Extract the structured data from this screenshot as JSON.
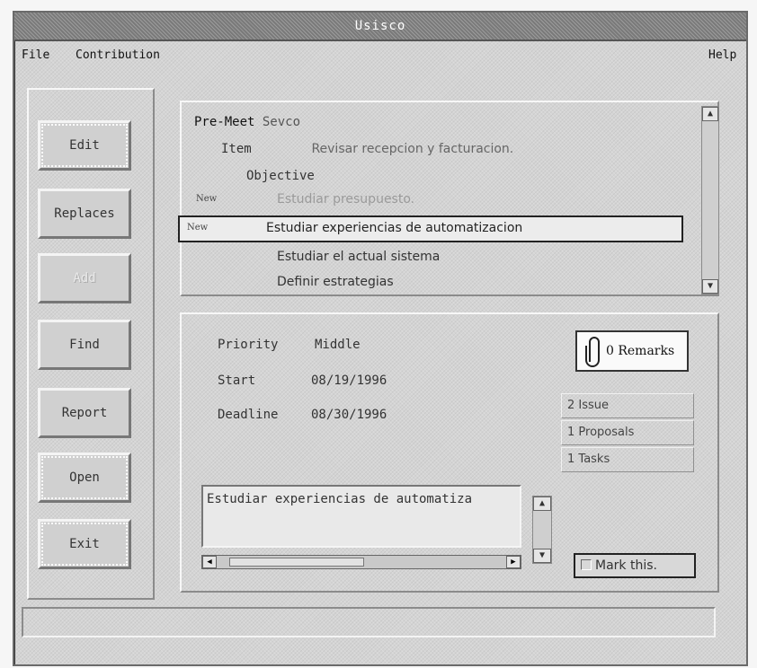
{
  "window": {
    "title": "Usisco"
  },
  "menu": {
    "file": "File",
    "contribution": "Contribution",
    "help": "Help"
  },
  "buttons": {
    "edit": "Edit",
    "replaces": "Replaces",
    "add": "Add",
    "find": "Find",
    "report": "Report",
    "open": "Open",
    "exit": "Exit"
  },
  "tree": {
    "premeet_label": "Pre-Meet",
    "premeet_value": "Sevco",
    "item_label": "Item",
    "item_value": "Revisar recepcion y facturacion.",
    "objective_label": "Objective",
    "new_tag": "New",
    "objectives": [
      "Estudiar presupuesto.",
      "Estudiar experiencias de automatizacion",
      "Estudiar el actual sistema",
      "Definir estrategias"
    ]
  },
  "details": {
    "priority_label": "Priority",
    "priority_value": "Middle",
    "start_label": "Start",
    "start_value": "08/19/1996",
    "deadline_label": "Deadline",
    "deadline_value": "08/30/1996",
    "description": "Estudiar experiencias de automatiza"
  },
  "side": {
    "remarks": "0 Remarks",
    "issue": "2 Issue",
    "proposals": "1 Proposals",
    "tasks": "1 Tasks",
    "mark_this": "Mark this."
  },
  "icons": {
    "up_arrow": "up-arrow-icon",
    "down_arrow": "down-arrow-icon",
    "left_arrow": "left-arrow-icon",
    "right_arrow": "right-arrow-icon",
    "paperclip": "paperclip-icon"
  }
}
